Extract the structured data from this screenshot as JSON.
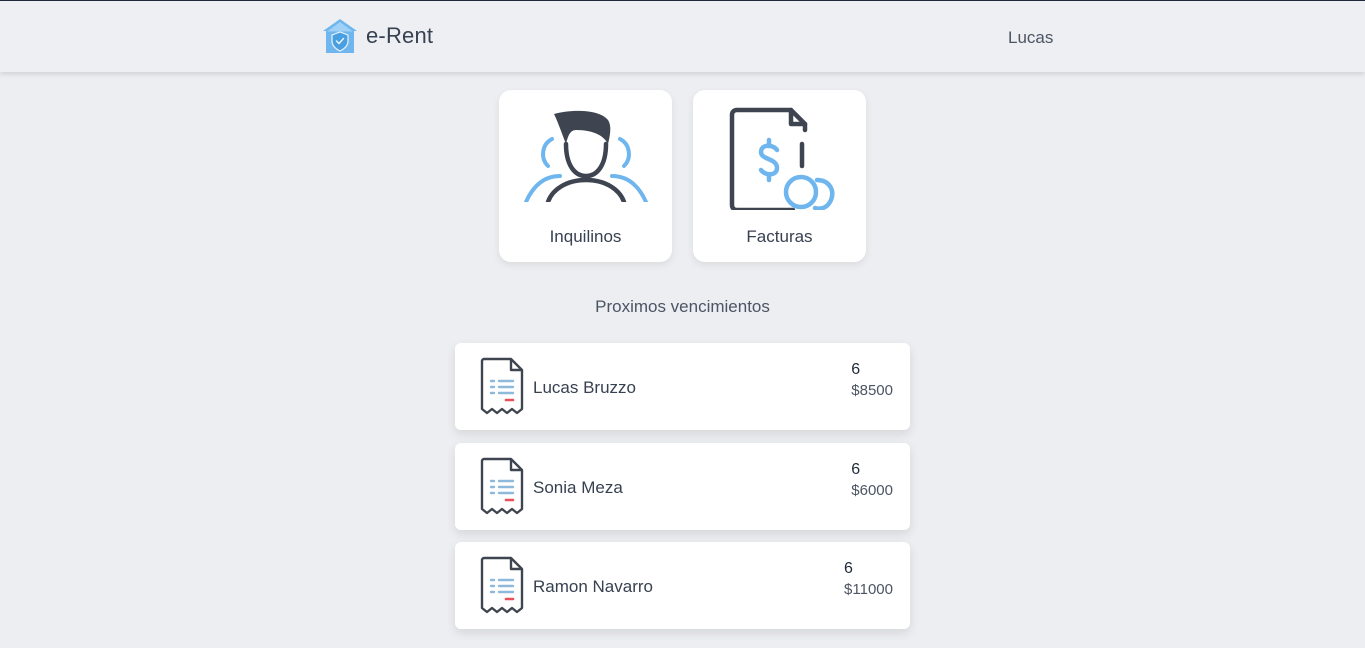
{
  "header": {
    "brand": "e-Rent",
    "user": "Lucas"
  },
  "tiles": [
    {
      "label": "Inquilinos",
      "icon": "tenants-icon"
    },
    {
      "label": "Facturas",
      "icon": "invoice-dollar-icon"
    }
  ],
  "section": {
    "title": "Proximos vencimientos"
  },
  "upcoming": [
    {
      "name": "Lucas Bruzzo",
      "count": "6",
      "amount": "$8500"
    },
    {
      "name": "Sonia Meza",
      "count": "6",
      "amount": "$6000"
    },
    {
      "name": "Ramon Navarro",
      "count": "6",
      "amount": "$11000"
    }
  ],
  "colors": {
    "accent": "#6fb6ee",
    "icon_dark": "#3f4550",
    "background": "#edeef1",
    "card": "#ffffff",
    "receipt_mark": "#e8505b"
  }
}
